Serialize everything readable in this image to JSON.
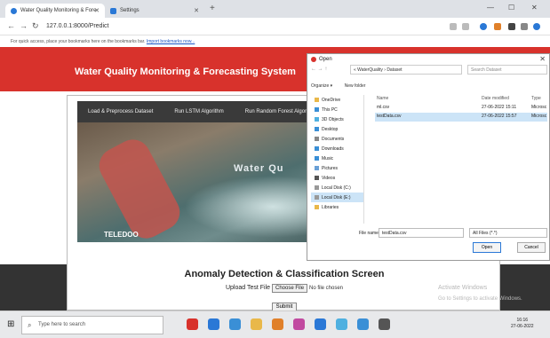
{
  "browser": {
    "tabs": [
      {
        "label": "Water Quality Monitoring & Fore",
        "icon": "chrome-favicon-icon"
      },
      {
        "label": "Settings",
        "icon": "gear-icon"
      }
    ],
    "url": "127.0.0.1:8000/Predict",
    "bookmark_hint": "For quick access, place your bookmarks here on the bookmarks bar.",
    "bookmark_link": "Import bookmarks now..."
  },
  "page": {
    "header_title": "Water Quality Monitoring & Forecasting System",
    "menu": [
      "Load & Preprocess Dataset",
      "Run LSTM Algorithm",
      "Run Random Forest Algorithm"
    ],
    "hero_text": "Water Qu",
    "hero_logo": "TELEDOO",
    "subtitle": "Anomaly Detection & Classification Screen",
    "upload_label": "Upload Test File",
    "choose_file": "Choose File",
    "no_file": "No file chosen",
    "submit": "Submit",
    "activate_title": "Activate Windows",
    "activate_sub": "Go to Settings to activate Windows."
  },
  "dialog": {
    "title": "Open",
    "path": "« WaterQuality › Dataset",
    "search_placeholder": "Search Dataset",
    "organize": "Organize ▾",
    "new_folder": "New folder",
    "nav_items": [
      "OneDrive",
      "This PC",
      "3D Objects",
      "Desktop",
      "Documents",
      "Downloads",
      "Music",
      "Pictures",
      "Videos",
      "Local Disk (C:)",
      "Local Disk (E:)",
      "Libraries"
    ],
    "columns": [
      "Name",
      "Date modified",
      "Type"
    ],
    "files": [
      {
        "name": "ml.csv",
        "date": "27-06-2022 15:11",
        "type": "Microsc"
      },
      {
        "name": "testData.csv",
        "date": "27-06-2022 15:57",
        "type": "Microsc"
      }
    ],
    "filename_label": "File name:",
    "filename": "testData.csv",
    "filetype": "All Files (*.*)",
    "open": "Open",
    "cancel": "Cancel"
  },
  "taskbar": {
    "search_placeholder": "Type here to search",
    "time": "16:16",
    "date": "27-06-2022"
  }
}
